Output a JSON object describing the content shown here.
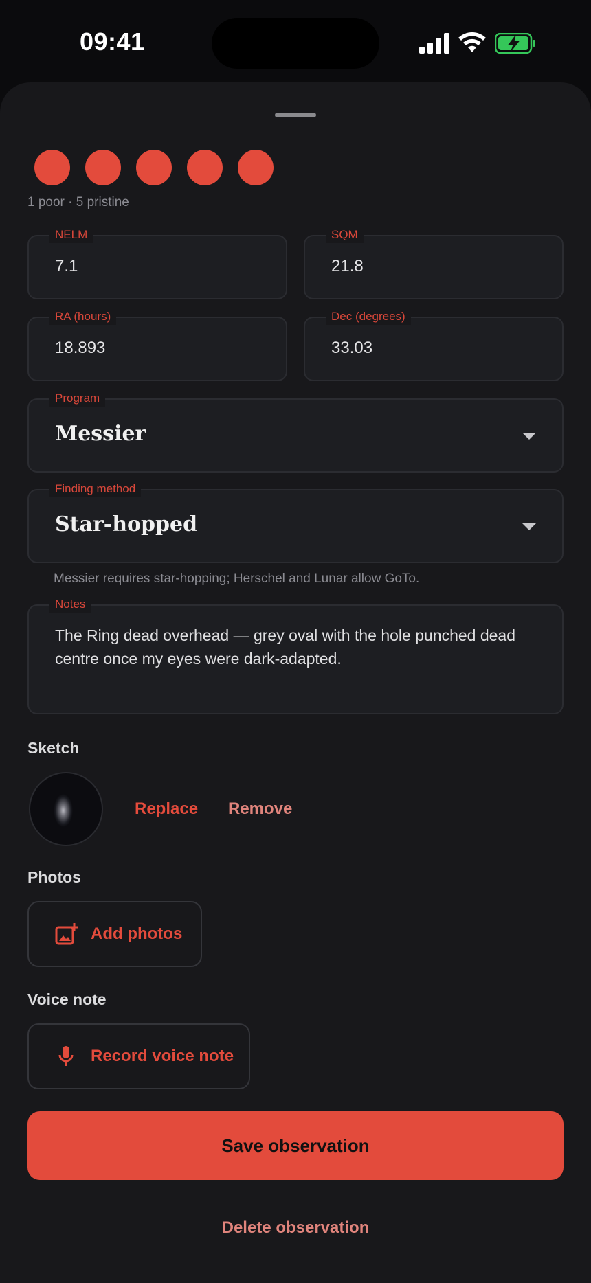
{
  "status_bar": {
    "time": "09:41"
  },
  "rating": {
    "filled": 5,
    "caption": "1 poor · 5 pristine",
    "color": "#e34b3c"
  },
  "fields": {
    "nelm": {
      "label": "NELM",
      "value": "7.1"
    },
    "sqm": {
      "label": "SQM",
      "value": "21.8"
    },
    "ra": {
      "label": "RA (hours)",
      "value": "18.893"
    },
    "dec": {
      "label": "Dec (degrees)",
      "value": "33.03"
    },
    "program": {
      "label": "Program",
      "value": "Messier"
    },
    "finding_method": {
      "label": "Finding method",
      "value": "Star-hopped",
      "helper": "Messier requires star-hopping; Herschel and Lunar allow GoTo."
    },
    "notes": {
      "label": "Notes",
      "value": "The Ring dead overhead — grey oval with the hole punched dead centre once my eyes were dark-adapted."
    }
  },
  "sketch": {
    "title": "Sketch",
    "replace_label": "Replace",
    "remove_label": "Remove"
  },
  "photos": {
    "title": "Photos",
    "add_label": "Add photos"
  },
  "voice": {
    "title": "Voice note",
    "record_label": "Record voice note"
  },
  "actions": {
    "save_label": "Save observation",
    "delete_label": "Delete observation"
  },
  "colors": {
    "accent": "#e34b3c",
    "sheet_bg": "#18181b",
    "screen_bg": "#0b0b0d"
  }
}
